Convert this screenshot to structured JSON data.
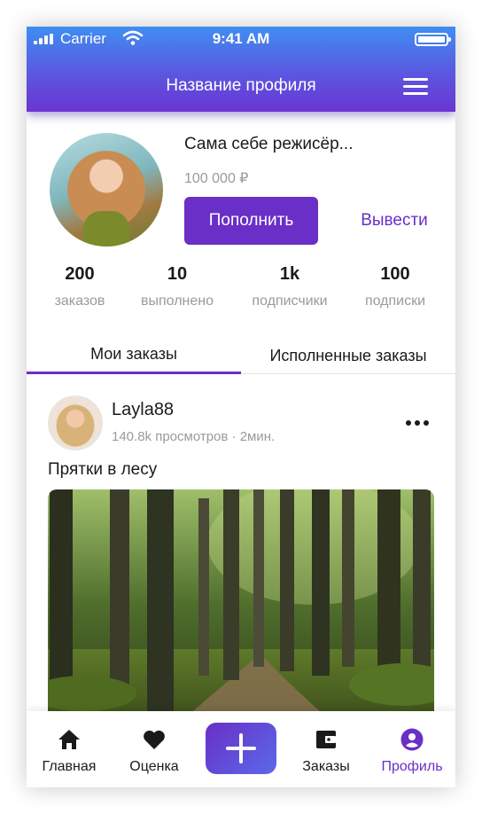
{
  "status_bar": {
    "carrier": "Carrier",
    "time": "9:41 AM"
  },
  "header": {
    "title": "Название профиля"
  },
  "profile": {
    "name": "Сама себе режисёр...",
    "balance": "100 000 ₽",
    "topup_label": "Пополнить",
    "withdraw_label": "Вывести"
  },
  "stats": [
    {
      "value": "200",
      "label": "заказов"
    },
    {
      "value": "10",
      "label": "выполнено"
    },
    {
      "value": "1k",
      "label": "подписчики"
    },
    {
      "value": "100",
      "label": "подписки"
    }
  ],
  "tabs": [
    {
      "label": "Мои заказы",
      "active": true
    },
    {
      "label": "Исполненные заказы",
      "active": false
    }
  ],
  "post": {
    "username": "Layla88",
    "meta": "140.8k просмотров · 2мин.",
    "title": "Прятки в лесу"
  },
  "bottom_nav": [
    {
      "label": "Главная",
      "icon": "home-icon"
    },
    {
      "label": "Оценка",
      "icon": "heart-icon"
    },
    {
      "label": "",
      "icon": "plus-icon"
    },
    {
      "label": "Заказы",
      "icon": "wallet-icon"
    },
    {
      "label": "Профиль",
      "icon": "user-circle-icon",
      "active": true
    }
  ],
  "colors": {
    "accent": "#6a2fc7",
    "header_top": "#3f8ef2",
    "header_bottom": "#6a36d2"
  }
}
